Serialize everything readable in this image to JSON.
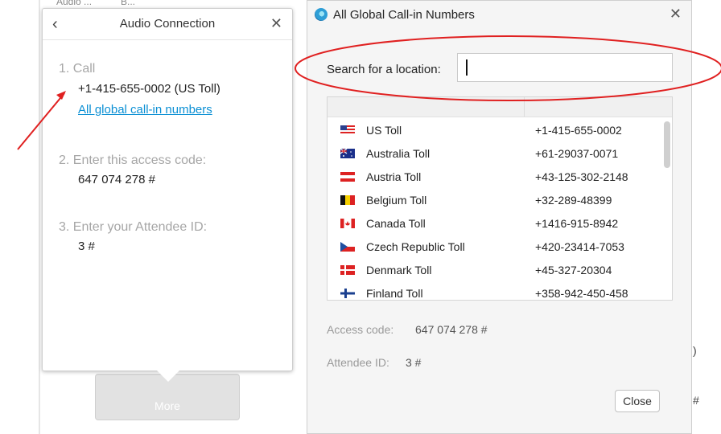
{
  "background": {
    "fragments": [
      "Audio ...",
      "B..."
    ],
    "right_edge_chars": [
      ")",
      "#"
    ]
  },
  "audio_connection": {
    "title": "Audio Connection",
    "back_icon": "chevron-left-icon",
    "close_icon": "close-icon",
    "step1_label": "1. Call",
    "step1_number": "+1-415-655-0002 (US Toll)",
    "step1_link": "All global call-in numbers",
    "step2_label": "2. Enter this access code:",
    "step2_value": "647 074 278 #",
    "step3_label": "3. Enter your Attendee ID:",
    "step3_value": "3 #",
    "more_button": "More"
  },
  "global_numbers": {
    "title": "All Global Call-in Numbers",
    "close_icon": "close-icon",
    "search_label": "Search for a location:",
    "search_value": "",
    "rows": [
      {
        "flag": "us-flag-icon",
        "country": "US Toll",
        "number": "+1-415-655-0002"
      },
      {
        "flag": "australia-flag-icon",
        "country": "Australia Toll",
        "number": "+61-29037-0071"
      },
      {
        "flag": "austria-flag-icon",
        "country": "Austria Toll",
        "number": "+43-125-302-2148"
      },
      {
        "flag": "belgium-flag-icon",
        "country": "Belgium Toll",
        "number": "+32-289-48399"
      },
      {
        "flag": "canada-flag-icon",
        "country": "Canada Toll",
        "number": "+1416-915-8942"
      },
      {
        "flag": "czech-flag-icon",
        "country": "Czech Republic Toll",
        "number": "+420-23414-7053"
      },
      {
        "flag": "denmark-flag-icon",
        "country": "Denmark Toll",
        "number": "+45-327-20304"
      },
      {
        "flag": "finland-flag-icon",
        "country": "Finland Toll",
        "number": "+358-942-450-458"
      }
    ],
    "access_code_label": "Access code:",
    "access_code_value": "647 074 278 #",
    "attendee_label": "Attendee ID:",
    "attendee_value": "3 #",
    "close_button": "Close"
  },
  "colors": {
    "link": "#0a8fd4",
    "annotation": "#e02020",
    "panel_background": "#ffffff",
    "dialog_background": "#f5f5f5"
  }
}
